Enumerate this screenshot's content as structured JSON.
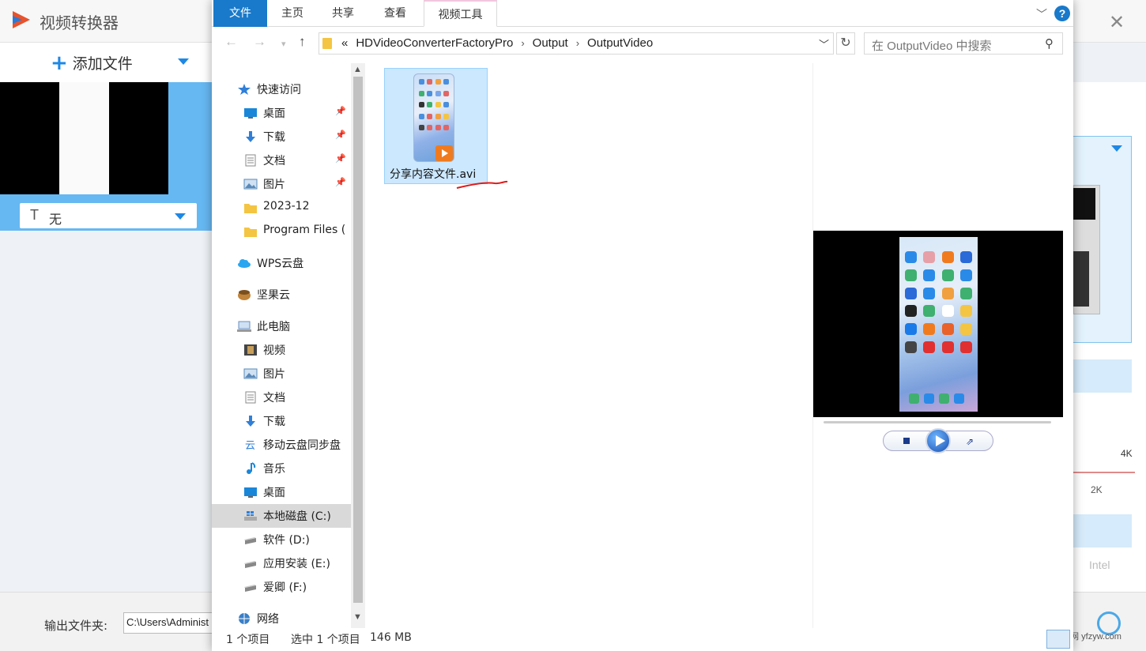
{
  "background_app": {
    "title": "视频转换器",
    "add_file_label": "添加文件",
    "subtitle_value": "无",
    "output_folder_label": "输出文件夹:",
    "output_folder_path": "C:\\Users\\Administ",
    "resolution_4k": "4K",
    "resolution_2k": "2K",
    "hw_intel": "Intel",
    "watermark": "©安卓资源网 yfzyw.com",
    "close_glyph": "✕"
  },
  "ribbon": {
    "tabs": [
      "文件",
      "主页",
      "共享",
      "查看",
      "视频工具"
    ]
  },
  "address": {
    "crumbs": [
      "HDVideoConverterFactoryPro",
      "Output",
      "OutputVideo"
    ],
    "overflow": "«",
    "separator": "›"
  },
  "search": {
    "placeholder": "在 OutputVideo 中搜索"
  },
  "sidebar": {
    "items": [
      {
        "label": "快速访问",
        "icon": "star-icon",
        "color": "#2f7fd8",
        "pinned": false
      },
      {
        "label": "桌面",
        "icon": "desktop-icon",
        "color": "#1a86d8",
        "pinned": true
      },
      {
        "label": "下载",
        "icon": "download-icon",
        "color": "#2f7fd8",
        "pinned": true
      },
      {
        "label": "文档",
        "icon": "document-icon",
        "color": "#8a8a8a",
        "pinned": true
      },
      {
        "label": "图片",
        "icon": "picture-icon",
        "color": "#5a8ab8",
        "pinned": true
      },
      {
        "label": "2023-12",
        "icon": "folder-icon",
        "color": "#f4c542",
        "pinned": false
      },
      {
        "label": "Program Files (",
        "icon": "folder-icon",
        "color": "#f4c542",
        "pinned": false
      },
      {
        "label": "WPS云盘",
        "icon": "cloud-icon",
        "color": "#2aa6f0",
        "pinned": false
      },
      {
        "label": "坚果云",
        "icon": "nut-icon",
        "color": "#c0843a",
        "pinned": false
      },
      {
        "label": "此电脑",
        "icon": "computer-icon",
        "color": "#6a8fc0",
        "pinned": false
      },
      {
        "label": "视频",
        "icon": "film-icon",
        "color": "#444",
        "pinned": false
      },
      {
        "label": "图片",
        "icon": "picture-icon",
        "color": "#5a8ab8",
        "pinned": false
      },
      {
        "label": "文档",
        "icon": "document-icon",
        "color": "#8a8a8a",
        "pinned": false
      },
      {
        "label": "下载",
        "icon": "download-icon",
        "color": "#2f7fd8",
        "pinned": false
      },
      {
        "label": "移动云盘同步盘",
        "icon": "sync-cloud-icon",
        "color": "#2f7fd8",
        "pinned": false
      },
      {
        "label": "音乐",
        "icon": "music-icon",
        "color": "#1a86d8",
        "pinned": false
      },
      {
        "label": "桌面",
        "icon": "desktop-icon",
        "color": "#1a86d8",
        "pinned": false
      },
      {
        "label": "本地磁盘 (C:)",
        "icon": "windows-drive-icon",
        "color": "#2f7fd8",
        "pinned": false
      },
      {
        "label": "软件 (D:)",
        "icon": "drive-icon",
        "color": "#888",
        "pinned": false
      },
      {
        "label": "应用安装 (E:)",
        "icon": "drive-icon",
        "color": "#888",
        "pinned": false
      },
      {
        "label": "爱卿 (F:)",
        "icon": "drive-icon",
        "color": "#888",
        "pinned": false
      },
      {
        "label": "网络",
        "icon": "network-icon",
        "color": "#3a7fc8",
        "pinned": false
      }
    ]
  },
  "file": {
    "name": "分享内容文件.avi",
    "selected": true
  },
  "status": {
    "count": "1 个项目",
    "selected": "选中 1 个项目",
    "size": "146 MB"
  }
}
